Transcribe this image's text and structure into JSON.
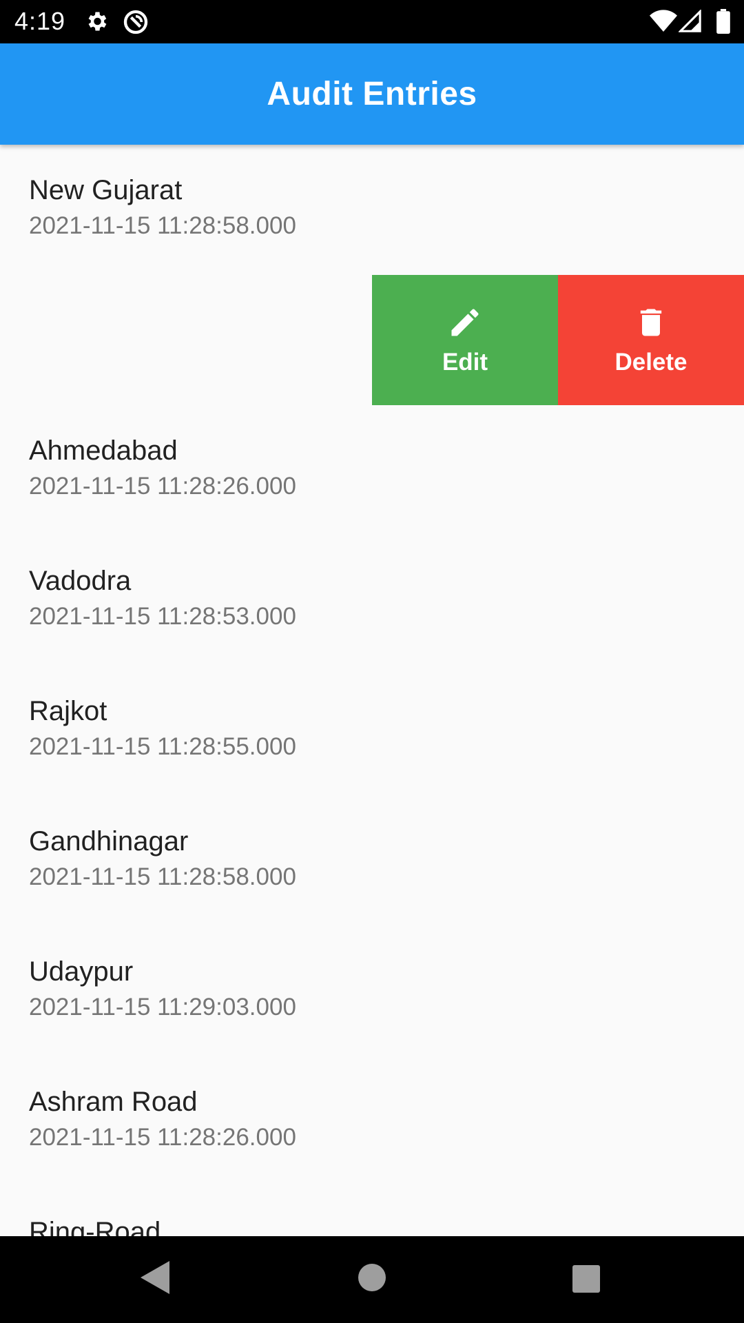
{
  "status_bar": {
    "time": "4:19",
    "icons": [
      "gear-icon",
      "sync-disabled-icon",
      "wifi-icon",
      "signal-icon",
      "battery-icon"
    ]
  },
  "app_bar": {
    "title": "Audit Entries",
    "color": "#2196f3"
  },
  "entries": [
    {
      "name": "New Gujarat",
      "timestamp": "2021-11-15 11:28:58.000"
    },
    {
      "name": "Ahmedabad",
      "timestamp": "2021-11-15 11:28:26.000"
    },
    {
      "name": "Vadodra",
      "timestamp": "2021-11-15 11:28:53.000"
    },
    {
      "name": "Rajkot",
      "timestamp": "2021-11-15 11:28:55.000"
    },
    {
      "name": "Gandhinagar",
      "timestamp": "2021-11-15 11:28:58.000"
    },
    {
      "name": "Udaypur",
      "timestamp": "2021-11-15 11:29:03.000"
    },
    {
      "name": "Ashram Road",
      "timestamp": "2021-11-15 11:28:26.000"
    },
    {
      "name": "Ring-Road",
      "timestamp": ""
    }
  ],
  "swipe_actions": {
    "edit_label": "Edit",
    "edit_color": "#4caf50",
    "edit_icon": "pencil-icon",
    "delete_label": "Delete",
    "delete_color": "#f44336",
    "delete_icon": "trash-icon"
  },
  "nav_bar": {
    "icons": [
      "back-icon",
      "home-icon",
      "recents-icon"
    ]
  }
}
